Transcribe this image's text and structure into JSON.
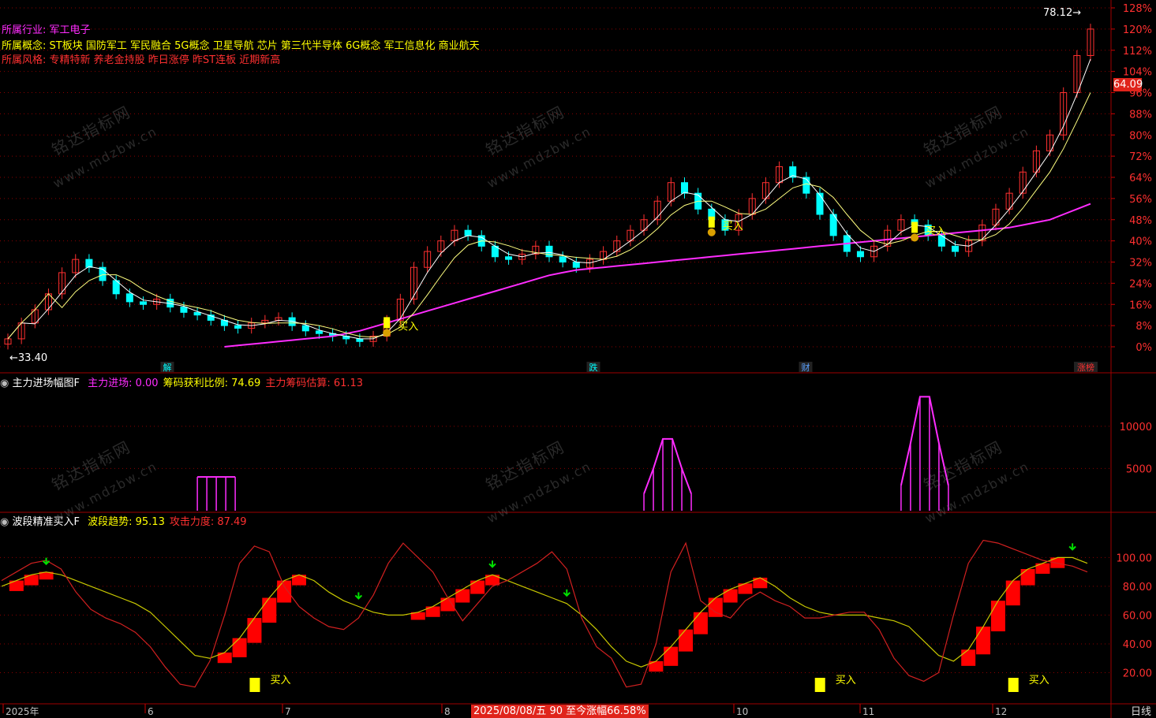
{
  "info": {
    "industry_label": "所属行业:",
    "industry_value": "军工电子",
    "concept_label": "所属概念:",
    "concept_value": "ST板块 国防军工 军民融合 5G概念 卫星导航 芯片 第三代半导体 6G概念 军工信息化 商业航天",
    "style_label": "所属风格:",
    "style_value": "专精特新 养老金持股 昨日涨停 昨ST连板 近期新高"
  },
  "panel2": {
    "title": "主力进场幅图F",
    "items": [
      {
        "label": "主力进场:",
        "value": "0.00",
        "color": "#ff2cff"
      },
      {
        "label": "筹码获利比例:",
        "value": "74.69",
        "color": "#ffff00"
      },
      {
        "label": "主力筹码估算:",
        "value": "61.13",
        "color": "#ff3030"
      }
    ]
  },
  "panel3": {
    "title": "波段精准买入F",
    "items": [
      {
        "label": "波段趋势:",
        "value": "95.13",
        "color": "#ffff00"
      },
      {
        "label": "攻击力度:",
        "value": "87.49",
        "color": "#ff3030"
      }
    ]
  },
  "status": {
    "date_readout": "2025/08/08/五 90 至今涨幅66.58%",
    "current_price": "64.09",
    "period": "日线"
  },
  "watermark": {
    "cn": "铭达指标网",
    "url": "www.mdzbw.cn"
  },
  "colors": {
    "up": "#ff3030",
    "down": "#00ffff",
    "ma_long": "#ff2cff",
    "ma_short": "#ffffff",
    "ma_mid": "#ffff80",
    "buy": "#ffff00",
    "grid": "#8b0000"
  },
  "chart_data": [
    {
      "type": "candlestick",
      "y_axis_labels": [
        "128%",
        "120%",
        "112%",
        "104%",
        "96%",
        "88%",
        "80%",
        "72%",
        "64%",
        "56%",
        "48%",
        "40%",
        "32%",
        "24%",
        "16%",
        "8%",
        "0%"
      ],
      "y_axis_percent": [
        128,
        120,
        112,
        104,
        96,
        88,
        80,
        72,
        64,
        56,
        48,
        40,
        32,
        24,
        16,
        8,
        0
      ],
      "base_price": 33.4,
      "low_label": "33.40",
      "high_label": "78.12",
      "event_tags": [
        "解",
        "跌",
        "财",
        "涨榜"
      ],
      "buy_label": "买入",
      "closes_pct": [
        3,
        9,
        14,
        20,
        28,
        33,
        30,
        25,
        20,
        17,
        16,
        18,
        15,
        13,
        12,
        10,
        8,
        7,
        9,
        10,
        11,
        8,
        6,
        5,
        4,
        3,
        2,
        4,
        10,
        18,
        30,
        36,
        40,
        44,
        42,
        38,
        34,
        33,
        35,
        38,
        34,
        32,
        30,
        33,
        36,
        40,
        44,
        48,
        55,
        62,
        58,
        52,
        48,
        44,
        50,
        56,
        62,
        68,
        64,
        58,
        50,
        42,
        36,
        34,
        38,
        44,
        48,
        46,
        42,
        38,
        36,
        40,
        46,
        52,
        58,
        66,
        74,
        80,
        96,
        110,
        120
      ],
      "ma_long_pct": [
        null,
        null,
        null,
        null,
        null,
        null,
        null,
        null,
        null,
        null,
        null,
        null,
        null,
        null,
        null,
        null,
        0,
        0.5,
        1,
        1.5,
        2,
        2.5,
        3,
        3.5,
        4,
        5,
        6,
        7.5,
        9,
        10.5,
        12,
        13.5,
        15,
        16.5,
        18,
        19.5,
        21,
        22.5,
        24,
        25.5,
        27,
        28,
        29,
        29.5,
        30,
        30.5,
        31,
        31.5,
        32,
        32.5,
        33,
        33.5,
        34,
        34.5,
        35,
        35.5,
        36,
        36.5,
        37,
        37.5,
        38,
        38.5,
        39,
        39.5,
        40,
        40.5,
        41,
        41.5,
        42,
        42.5,
        43,
        43.5,
        44,
        44.5,
        45,
        46,
        47,
        48,
        50,
        52,
        54
      ],
      "buy_points_index": [
        28,
        52,
        67
      ]
    },
    {
      "type": "bar",
      "name": "主力进场",
      "y_axis_labels": [
        "10000",
        "5000"
      ],
      "y_ticks": [
        10000,
        5000
      ],
      "segments": [
        {
          "start_index": 14,
          "values": [
            4000,
            4000,
            4000,
            4000,
            4000
          ]
        },
        {
          "start_index": 47,
          "values": [
            2000,
            5000,
            8500,
            8500,
            5000,
            2000
          ]
        },
        {
          "start_index": 66,
          "values": [
            3000,
            8000,
            13500,
            13500,
            8000,
            3000
          ]
        }
      ]
    },
    {
      "type": "line",
      "y_axis_labels": [
        "100.00",
        "80.00",
        "60.00",
        "40.00",
        "20.00"
      ],
      "y_ticks": [
        100,
        80,
        60,
        40,
        20
      ],
      "buy_label": "买入",
      "trend_series": [
        80,
        84,
        88,
        90,
        88,
        84,
        80,
        76,
        72,
        68,
        62,
        52,
        42,
        32,
        30,
        34,
        44,
        58,
        72,
        84,
        88,
        84,
        76,
        70,
        66,
        62,
        60,
        60,
        62,
        66,
        72,
        78,
        84,
        88,
        84,
        80,
        76,
        72,
        68,
        60,
        50,
        38,
        28,
        24,
        28,
        38,
        50,
        62,
        72,
        78,
        82,
        86,
        80,
        72,
        66,
        62,
        60,
        60,
        60,
        58,
        56,
        52,
        42,
        32,
        28,
        36,
        52,
        70,
        84,
        92,
        96,
        100,
        100,
        96
      ],
      "attack_series": [
        84,
        90,
        96,
        98,
        92,
        76,
        64,
        58,
        54,
        48,
        38,
        24,
        12,
        10,
        28,
        60,
        96,
        108,
        104,
        80,
        66,
        58,
        52,
        50,
        58,
        74,
        96,
        110,
        100,
        90,
        72,
        56,
        68,
        80,
        84,
        90,
        96,
        104,
        92,
        58,
        38,
        30,
        10,
        12,
        40,
        90,
        110,
        70,
        62,
        58,
        70,
        76,
        70,
        66,
        58,
        58,
        60,
        62,
        62,
        50,
        30,
        18,
        14,
        20,
        60,
        96,
        112,
        110,
        106,
        102,
        98,
        96,
        94,
        90
      ],
      "buy_points_index": [
        17,
        55,
        68
      ],
      "sell_points_index": [
        3,
        24,
        33,
        38,
        72
      ]
    }
  ]
}
